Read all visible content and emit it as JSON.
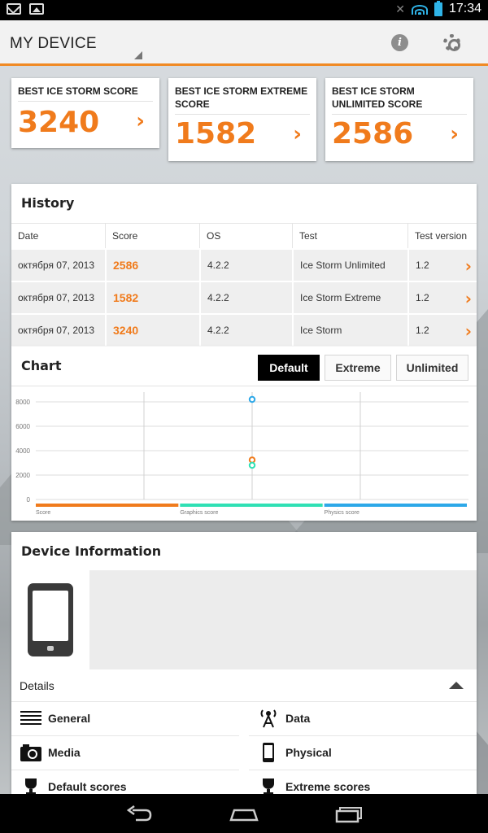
{
  "status_bar": {
    "time": "17:34",
    "icons": [
      "gmail-icon",
      "gallery-icon",
      "mute-icon",
      "wifi-icon",
      "battery-icon"
    ]
  },
  "action_bar": {
    "title": "MY DEVICE",
    "info_icon": "i",
    "settings_icon": "gear-icon"
  },
  "score_cards": [
    {
      "title": "BEST ICE STORM SCORE",
      "score": "3240",
      "arrow": "›"
    },
    {
      "title": "BEST ICE STORM EXTREME SCORE",
      "score": "1582",
      "arrow": "›"
    },
    {
      "title": "BEST ICE STORM UNLIMITED SCORE",
      "score": "2586",
      "arrow": "›"
    }
  ],
  "history": {
    "title": "History",
    "columns": [
      "Date",
      "Score",
      "OS",
      "Test",
      "Test version"
    ],
    "rows": [
      {
        "date": "октября 07, 2013",
        "score": "2586",
        "os": "4.2.2",
        "test": "Ice Storm Unlimited",
        "version": "1.2"
      },
      {
        "date": "октября 07, 2013",
        "score": "1582",
        "os": "4.2.2",
        "test": "Ice Storm Extreme",
        "version": "1.2"
      },
      {
        "date": "октября 07, 2013",
        "score": "3240",
        "os": "4.2.2",
        "test": "Ice Storm",
        "version": "1.2"
      }
    ]
  },
  "chart_panel": {
    "title": "Chart",
    "segments": [
      "Default",
      "Extreme",
      "Unlimited"
    ],
    "selected": "Default"
  },
  "chart_data": {
    "type": "scatter",
    "title": "",
    "xlabel": "",
    "ylabel": "",
    "y_ticks": [
      "8000",
      "6000",
      "4000",
      "2000",
      "0"
    ],
    "ylim": [
      0,
      8000
    ],
    "x_bands": 4,
    "grid": true,
    "series": [
      {
        "name": "Score",
        "color": "#f07b1c",
        "x": [
          2
        ],
        "values": [
          3240
        ]
      },
      {
        "name": "Graphics score",
        "color": "#2fe0b4",
        "x": [
          2
        ],
        "values": [
          2800
        ]
      },
      {
        "name": "Physics score",
        "color": "#2da8e8",
        "x": [
          2
        ],
        "values": [
          8200
        ]
      }
    ]
  },
  "device_info": {
    "title": "Device Information",
    "details_label": "Details",
    "items": [
      {
        "label": "General",
        "icon": "list-icon"
      },
      {
        "label": "Data",
        "icon": "antenna-icon"
      },
      {
        "label": "Media",
        "icon": "camera-icon"
      },
      {
        "label": "Physical",
        "icon": "phone-icon"
      },
      {
        "label": "Default scores",
        "icon": "trophy-icon"
      },
      {
        "label": "Extreme scores",
        "icon": "trophy-icon"
      }
    ]
  },
  "nav_bar": {
    "icons": [
      "back-icon",
      "home-icon",
      "recents-icon"
    ]
  }
}
